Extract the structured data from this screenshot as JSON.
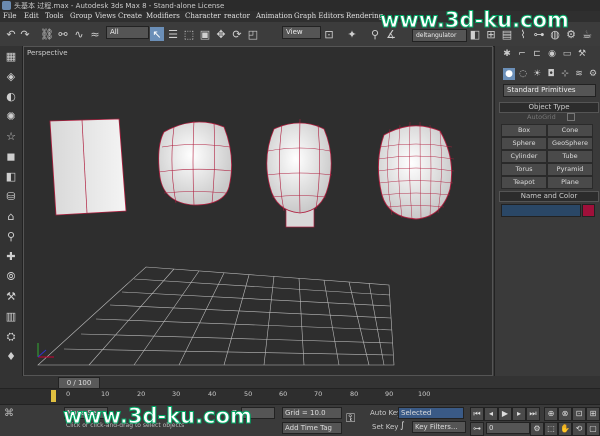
{
  "window": {
    "title": "头基本 过程.max - Autodesk 3ds Max 8 - Stand-alone License"
  },
  "menu": [
    "File",
    "Edit",
    "Tools",
    "Group",
    "Views",
    "Create",
    "Modifiers",
    "Character",
    "reactor",
    "Animation",
    "Graph Editors",
    "Rendering"
  ],
  "toolbar": {
    "selection_filter": "All",
    "ref_coord": "View",
    "named_set": "deltangulator"
  },
  "viewport": {
    "label": "Perspective"
  },
  "command_panel": {
    "category": "Standard Primitives",
    "object_type_title": "Object Type",
    "autogrid_label": "AutoGrid",
    "buttons": [
      "Box",
      "Cone",
      "Sphere",
      "GeoSphere",
      "Cylinder",
      "Tube",
      "Torus",
      "Pyramid",
      "Teapot",
      "Plane"
    ],
    "name_color_title": "Name and Color",
    "object_color": "#a0103a"
  },
  "timeline": {
    "frame_display": "0 / 100",
    "ruler_labels": [
      "0",
      "10",
      "20",
      "30",
      "40",
      "50",
      "60",
      "70",
      "80",
      "90",
      "100"
    ]
  },
  "status": {
    "selection": "None Se",
    "prompt": "Click or click-and-drag to select objects",
    "z_label": "Z:",
    "grid": "Grid = 10.0",
    "add_time_tag": "Add Time Tag",
    "auto_key": "Auto Key",
    "set_key": "Set Key",
    "key_mode": "Selected",
    "key_filters": "Key Filters...",
    "frame": "0"
  },
  "watermark": "www.3d-ku.com"
}
